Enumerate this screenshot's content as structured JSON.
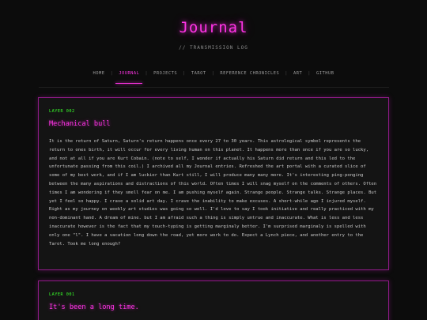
{
  "header": {
    "title": "Journal",
    "subtitle": "// TRANSMISSION LOG"
  },
  "nav": {
    "items": [
      {
        "label": "HOME",
        "active": false
      },
      {
        "label": "JOURNAL",
        "active": true
      },
      {
        "label": "PROJECTS",
        "active": false
      },
      {
        "label": "TAROT",
        "active": false
      },
      {
        "label": "REFERENCE CHRONICLES",
        "active": false
      },
      {
        "label": "ART",
        "active": false
      },
      {
        "label": "GITHUB",
        "active": false
      }
    ]
  },
  "entries": [
    {
      "label": "LAYER 002",
      "title": "Mechanical bull",
      "body": "It is the return of Saturn, Saturn's return happens once every 27 to 30 years. This astrological symbol represents the return to ones birth, it will occur for every living human on this planet. It happens more than once if you are so lucky, and not at all if you are Kurt Cobain. (note to self, I wonder if actually his Saturn did return and this led to the unfortunate passing from this coil.) I archived all my Journal entries. Refreshed the art portal with a curated slice of some of my best work, and if I am luckier than Kurt still, I will produce many many more. It's interesting ping-ponging between the many aspirations and distractions of this world. Often times I will snag myself on the comments of others. Often times I am wondering if they smell fear on me. I am pushing myself again. Strange people. Strange talks. Strange places. But yet I feel so happy. I crave a solid art day. I crave the inability to make excuses. A short-while ago I injured myself. Right as my journey on weekly art studies was going so well. I'd love to say I took initiative and really practiced with my non-dominant hand. A dream of mine. but I am afraid such a thing is simply untrue and inaccurate. What is less and less inaccurate however is the fact that my touch-typing is getting marginaly better. I'm surprised marginaly is spelled with only one \"l\". I have a vacation long down the road, yet more work to do. Expect a Lynch piece, and another entry to the Tarot. Took me long enough?"
    },
    {
      "label": "LAYER 001",
      "title": "It's been a long time.",
      "body": ""
    }
  ],
  "colors": {
    "accent": "#ff33e6",
    "label": "#39ff2a",
    "background": "#0c0c0c",
    "card": "#141414",
    "border": "#8e1a86"
  }
}
